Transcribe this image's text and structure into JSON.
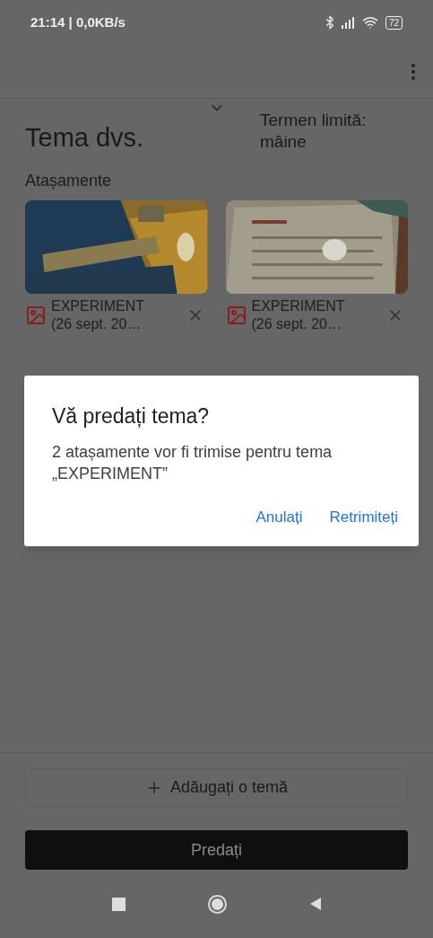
{
  "status_bar": {
    "time": "21:14 | 0,0KB/s",
    "battery": "72"
  },
  "assignment": {
    "title": "Tema dvs.",
    "due": "Termen limită: mâine"
  },
  "attachments": {
    "heading": "Atașamente",
    "items": [
      {
        "name": "EXPERIMENT",
        "date": "(26 sept. 20…"
      },
      {
        "name": "EXPERIMENT",
        "date": "(26 sept. 20…"
      }
    ]
  },
  "dialog": {
    "title": "Vă predați tema?",
    "message": "2 atașamente vor fi trimise pentru tema „EXPERIMENT”",
    "buttons": [
      "Anulați",
      "Retrimiteți"
    ]
  },
  "add_button": {
    "label": "Adăugați o temă"
  },
  "submit_button": {
    "label": "Predați"
  }
}
